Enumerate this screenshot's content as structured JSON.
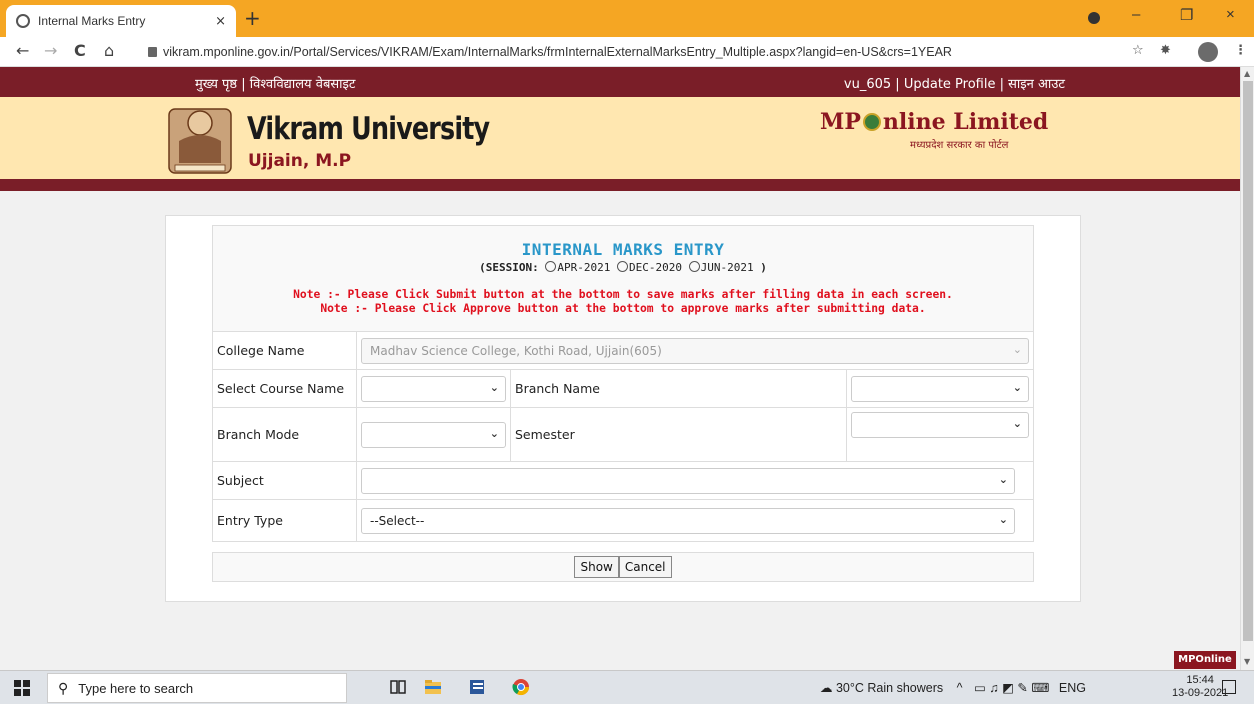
{
  "browser": {
    "tab_title": "Internal Marks Entry",
    "tab_close": "×",
    "new_tab": "+",
    "url": "vikram.mponline.gov.in/Portal/Services/VIKRAM/Exam/InternalMarks/frmInternalExternalMarksEntry_Multiple.aspx?langid=en-US&crs=1YEAR",
    "nav_back": "←",
    "nav_forward": "→",
    "nav_reload": "C",
    "nav_home": "⌂",
    "win_minimize": "–",
    "win_restore": "❐",
    "win_close": "×",
    "menu_icon": "⋮",
    "star_icon": "☆"
  },
  "topbar": {
    "left_links": "मुख्य पृष्ठ | विश्वविद्यालय वेबसाइट",
    "user": "vu_605",
    "sep1": "|",
    "update_profile": "Update Profile",
    "sep2": "|",
    "signout": "साइन आउट"
  },
  "header": {
    "university_name": "Vikram University",
    "university_place": "Ujjain, M.P",
    "mp_prefix": "MP",
    "mp_suffix": "nline Limited",
    "mp_subtitle": "मध्यप्रदेश सरकार का पोर्टल"
  },
  "form": {
    "title": "INTERNAL MARKS ENTRY",
    "session_open": "(",
    "session_label": "SESSION:",
    "session_options": [
      "APR-2021",
      "DEC-2020",
      "JUN-2021"
    ],
    "session_close": ")",
    "note1": "Note :- Please Click Submit button at the bottom to save marks after filling data in each screen.",
    "note2": "Note :- Please Click Approve button at the bottom to approve marks after submitting data.",
    "college_label": "College Name",
    "college_value": "Madhav Science College, Kothi Road, Ujjain(605)",
    "course_label": "Select Course Name",
    "course_value": "",
    "branch_label": "Branch Name",
    "branch_value": "",
    "mode_label": "Branch Mode",
    "mode_value": "",
    "semester_label": "Semester",
    "semester_value": "",
    "subject_label": "Subject",
    "subject_value": "",
    "entry_label": "Entry Type",
    "entry_value": "--Select--",
    "show_button": "Show",
    "cancel_button": "Cancel"
  },
  "badge": "MPOnline",
  "taskbar": {
    "search_placeholder": "Type here to search",
    "weather": "30°C  Rain showers",
    "lang": "ENG",
    "time": "15:44",
    "date": "13-09-2021"
  }
}
